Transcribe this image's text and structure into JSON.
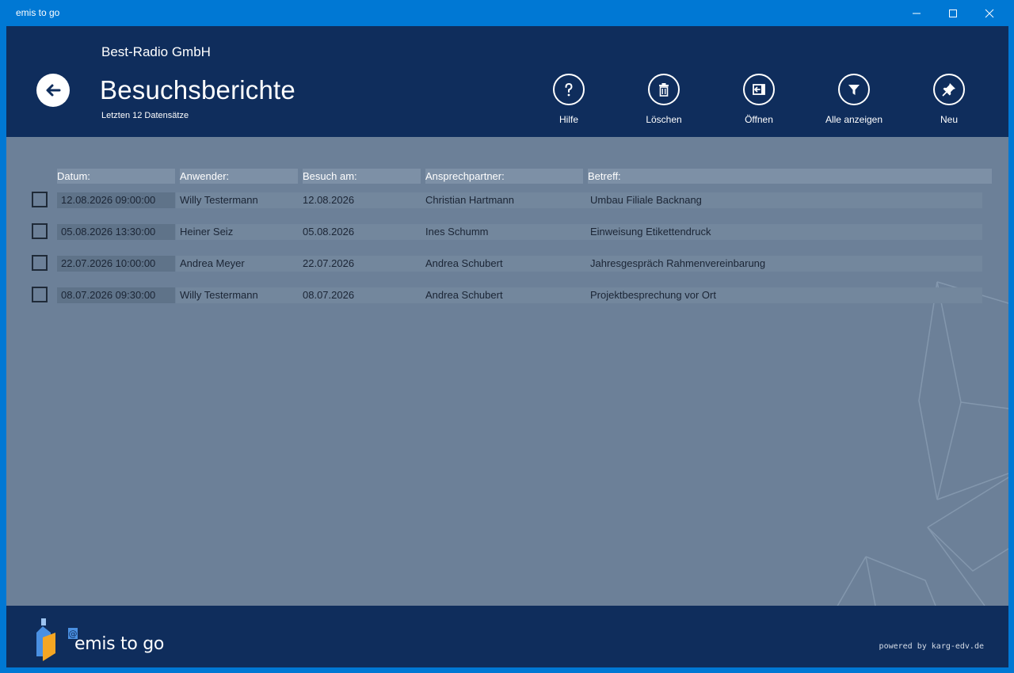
{
  "window": {
    "title": "emis to go",
    "minimize_icon": "minimize-icon",
    "maximize_icon": "maximize-icon",
    "close_icon": "close-icon"
  },
  "header": {
    "company": "Best-Radio GmbH",
    "title": "Besuchsberichte",
    "subtitle": "Letzten 12 Datensätze",
    "back_icon": "arrow-left-icon"
  },
  "toolbar": [
    {
      "label": "Hilfe",
      "icon": "question-icon"
    },
    {
      "label": "Löschen",
      "icon": "trash-icon"
    },
    {
      "label": "Öffnen",
      "icon": "open-icon"
    },
    {
      "label": "Alle anzeigen",
      "icon": "filter-icon"
    },
    {
      "label": "Neu",
      "icon": "pin-icon"
    }
  ],
  "table": {
    "columns": [
      "Datum:",
      "Anwender:",
      "Besuch am:",
      "Ansprechpartner:",
      "Betreff:"
    ],
    "rows": [
      {
        "datum": "12.08.2026 09:00:00",
        "anwender": "Willy Testermann",
        "besuch": "12.08.2026",
        "ansprechpartner": "Christian Hartmann",
        "betreff": "Umbau Filiale Backnang"
      },
      {
        "datum": "05.08.2026 13:30:00",
        "anwender": "Heiner Seiz",
        "besuch": "05.08.2026",
        "ansprechpartner": "Ines Schumm",
        "betreff": "Einweisung Etikettendruck"
      },
      {
        "datum": "22.07.2026 10:00:00",
        "anwender": "Andrea Meyer",
        "besuch": "22.07.2026",
        "ansprechpartner": "Andrea Schubert",
        "betreff": "Jahresgespräch Rahmenvereinbarung"
      },
      {
        "datum": "08.07.2026 09:30:00",
        "anwender": "Willy Testermann",
        "besuch": "08.07.2026",
        "ansprechpartner": "Andrea Schubert",
        "betreff": "Projektbesprechung vor Ort"
      }
    ]
  },
  "footer": {
    "brand": "emis to go",
    "logo_at": "@",
    "powered": "powered by karg-edv.de"
  },
  "colors": {
    "titlebar": "#0078d4",
    "header": "#0f2d5c",
    "content": "#6c8098",
    "accent_logo": "#f5a623"
  }
}
